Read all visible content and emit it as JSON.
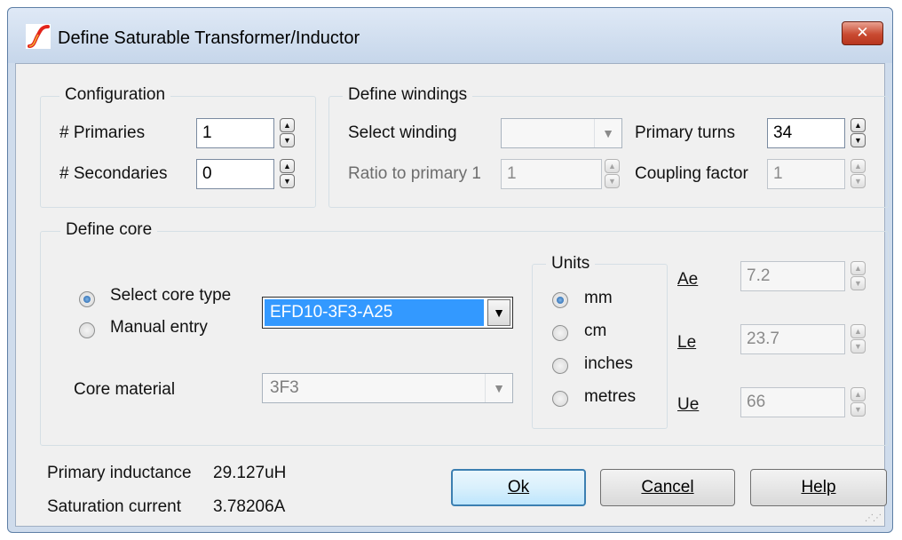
{
  "window": {
    "title": "Define Saturable Transformer/Inductor",
    "close_glyph": "✕",
    "app_icon": "simetrix-logo-icon"
  },
  "configuration": {
    "group_label": "Configuration",
    "primaries_label": "# Primaries",
    "primaries_value": "1",
    "secondaries_label": "# Secondaries",
    "secondaries_value": "0"
  },
  "windings": {
    "group_label": "Define windings",
    "select_winding_label": "Select winding",
    "select_winding_value": "",
    "ratio_label": "Ratio to primary 1",
    "ratio_value": "1",
    "primary_turns_label": "Primary turns",
    "primary_turns_value": "34",
    "coupling_label": "Coupling factor",
    "coupling_value": "1"
  },
  "core": {
    "group_label": "Define core",
    "select_core_type_label": "Select core type",
    "manual_entry_label": "Manual entry",
    "selected_mode": "select_core_type",
    "core_type_value": "EFD10-3F3-A25",
    "core_material_label": "Core material",
    "core_material_value": "3F3",
    "units": {
      "group_label": "Units",
      "options": [
        "mm",
        "cm",
        "inches",
        "metres"
      ],
      "selected": "mm"
    },
    "ae_label": "Ae",
    "ae_value": "7.2",
    "le_label": "Le",
    "le_value": "23.7",
    "ue_label": "Ue",
    "ue_value": "66"
  },
  "results": {
    "primary_inductance_label": "Primary inductance",
    "primary_inductance_value": "29.127uH",
    "saturation_current_label": "Saturation current",
    "saturation_current_value": "3.78206A"
  },
  "buttons": {
    "ok": "Ok",
    "cancel": "Cancel",
    "help": "Help"
  },
  "colors": {
    "selection": "#3399ff",
    "close_button": "#c94a31",
    "dialog_bg": "#f0f0f0"
  }
}
